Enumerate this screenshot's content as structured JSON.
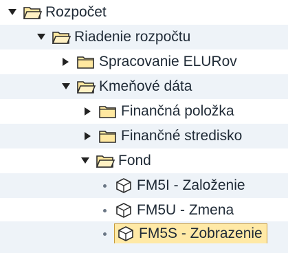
{
  "tree": {
    "items": [
      {
        "label": "Rozpočet",
        "icon": "folder-open-icon",
        "toggle": "expanded"
      },
      {
        "label": "Riadenie rozpočtu",
        "icon": "folder-open-icon",
        "toggle": "expanded"
      },
      {
        "label": "Spracovanie ELURov",
        "icon": "folder-closed-icon",
        "toggle": "collapsed"
      },
      {
        "label": "Kmeňové dáta",
        "icon": "folder-open-icon",
        "toggle": "expanded"
      },
      {
        "label": "Finančná položka",
        "icon": "folder-closed-icon",
        "toggle": "collapsed"
      },
      {
        "label": "Finančné stredisko",
        "icon": "folder-closed-icon",
        "toggle": "collapsed"
      },
      {
        "label": "Fond",
        "icon": "folder-open-icon",
        "toggle": "expanded"
      },
      {
        "label": "FM5I - Založenie",
        "icon": "transaction-cube-icon",
        "toggle": "leaf"
      },
      {
        "label": "FM5U - Zmena",
        "icon": "transaction-cube-icon",
        "toggle": "leaf"
      },
      {
        "label": "FM5S - Zobrazenie",
        "icon": "transaction-cube-icon",
        "toggle": "leaf",
        "selected": true
      }
    ]
  },
  "colors": {
    "folder_fill": "#ffe8a0",
    "folder_stroke": "#2b2b2b",
    "selection_fill": "#ffe9a6",
    "row_shade": "#eef3f8"
  }
}
